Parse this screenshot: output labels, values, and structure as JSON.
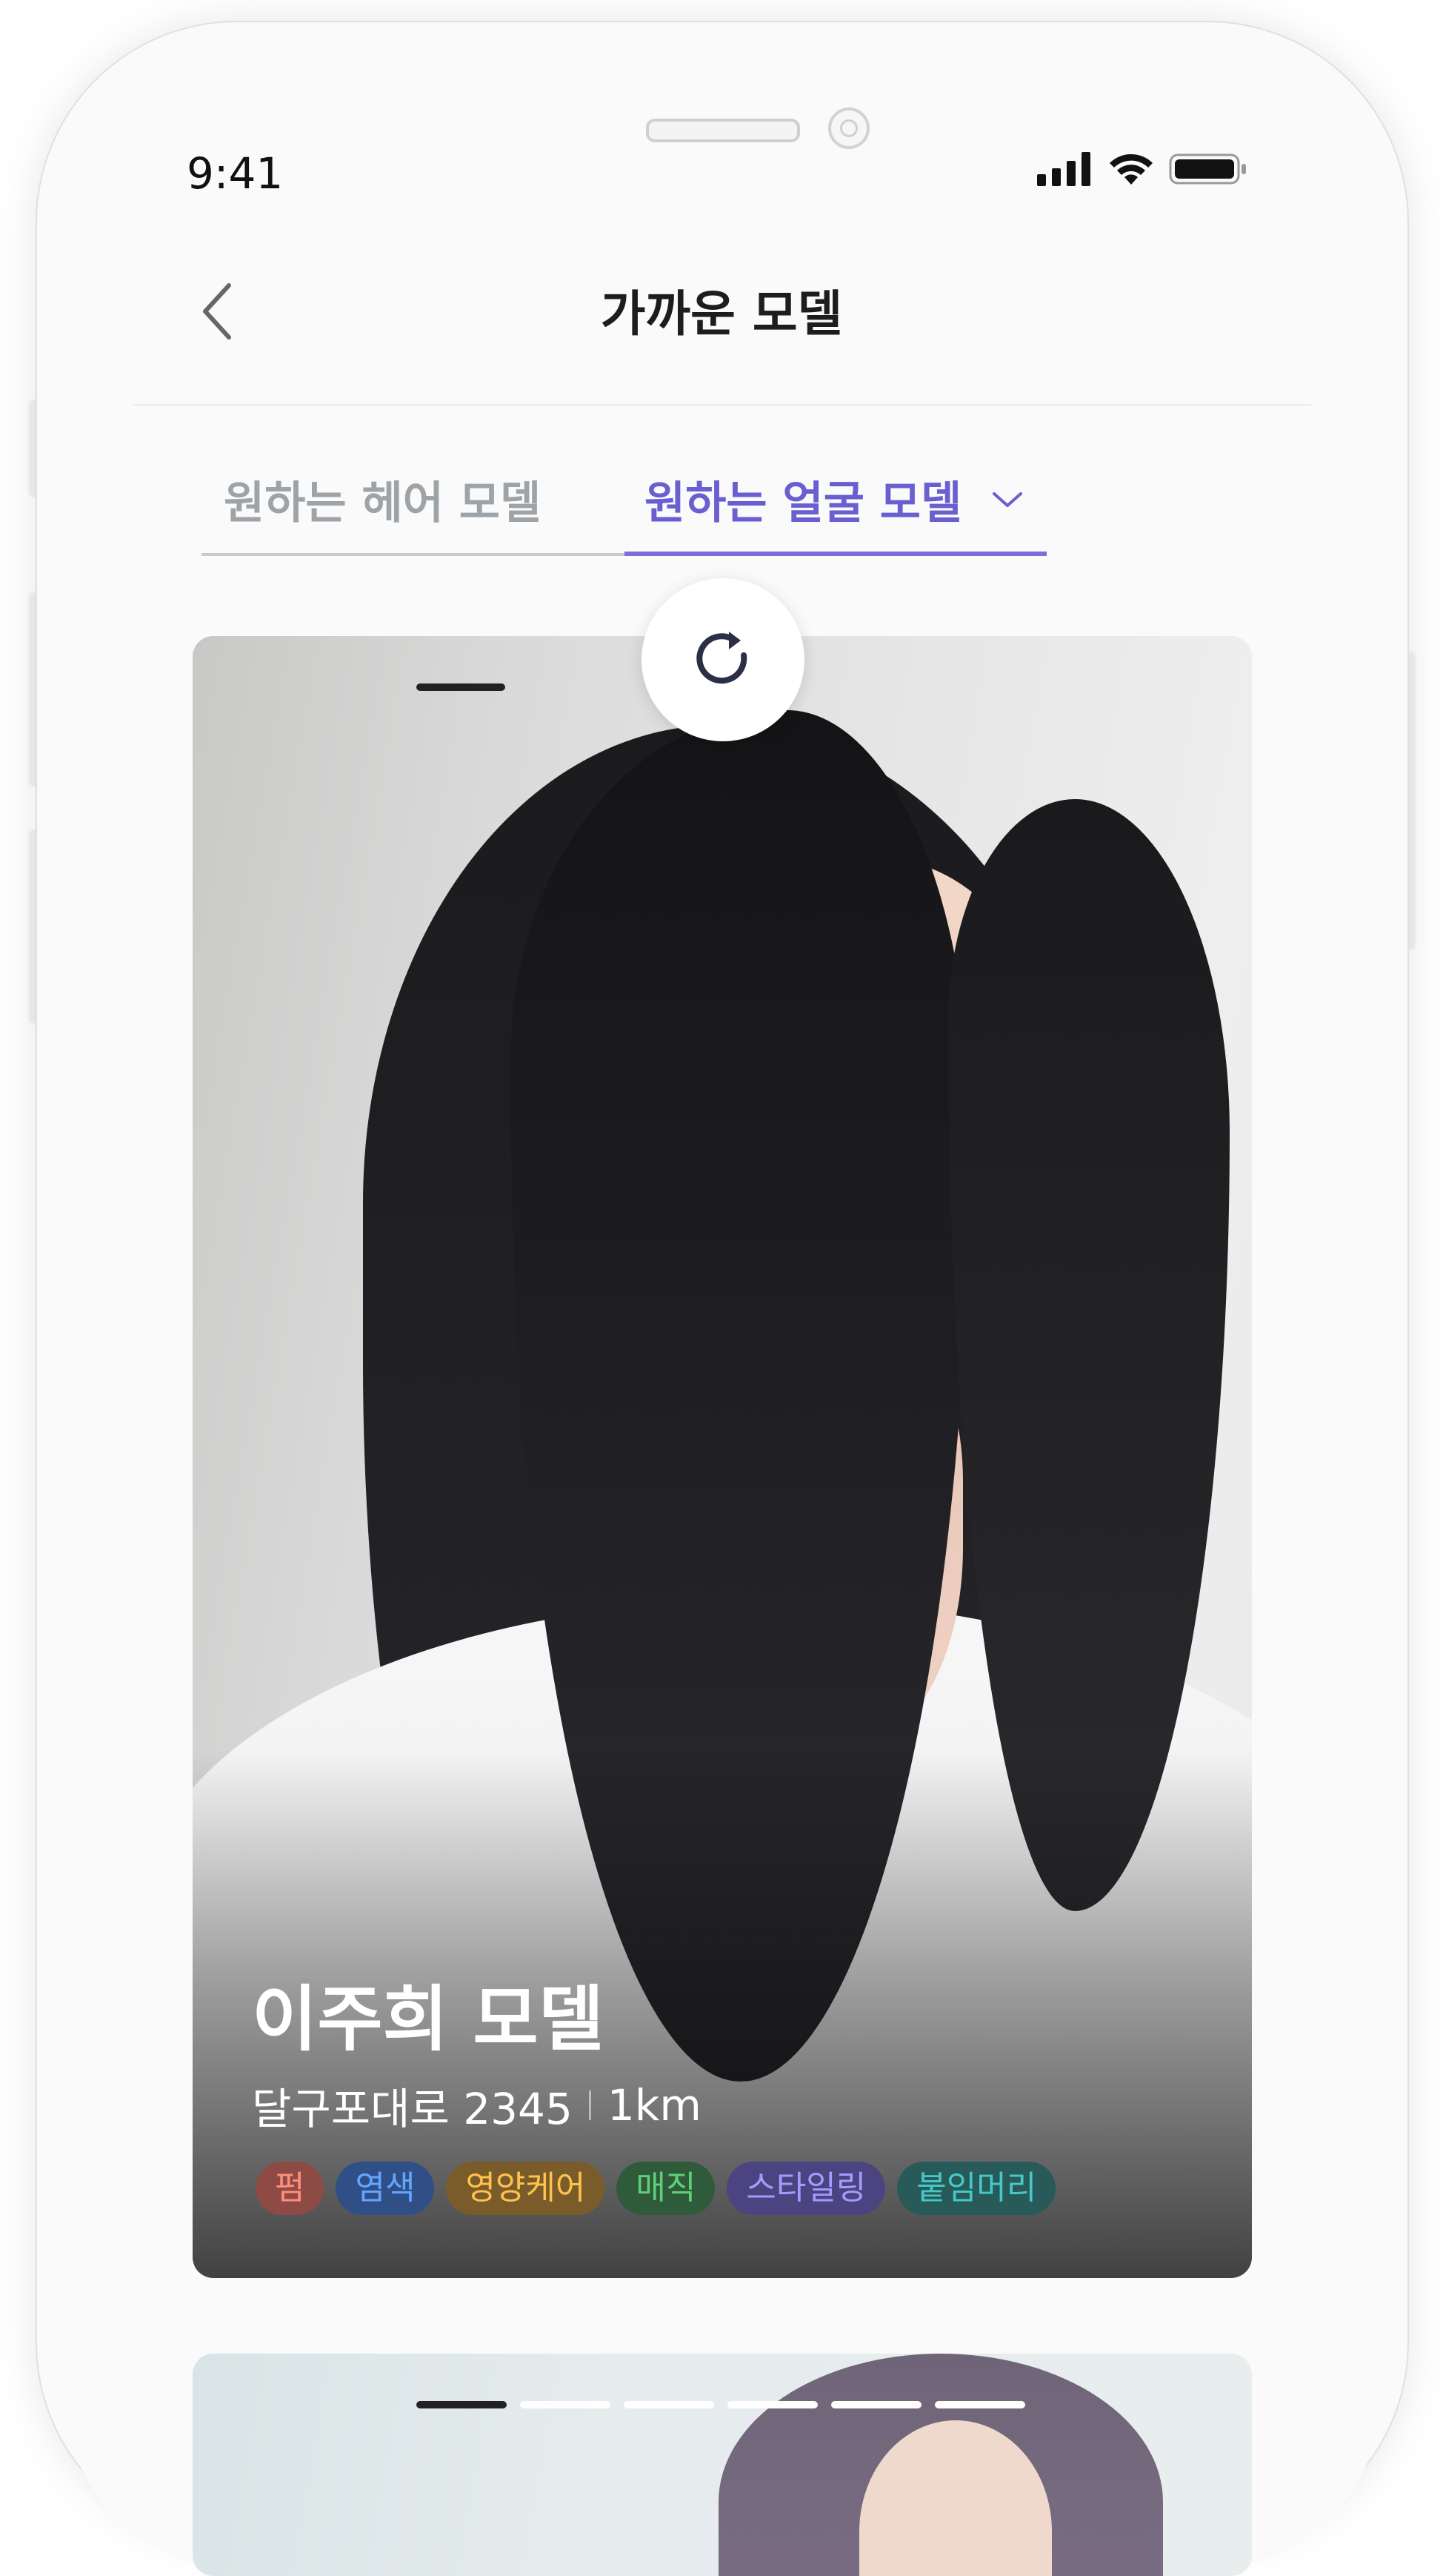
{
  "status_bar": {
    "time": "9:41"
  },
  "header": {
    "title": "가까운 모델"
  },
  "tabs": [
    {
      "label": "원하는 헤어 모델",
      "active": false
    },
    {
      "label": "원하는 얼굴 모델",
      "active": true
    }
  ],
  "cards": [
    {
      "name": "이주희 모델",
      "address": "달구포대로 2345",
      "distance": "1km",
      "tags": [
        {
          "label": "펌",
          "bg": "#8e4a44",
          "color": "#ff8f7a"
        },
        {
          "label": "염색",
          "bg": "#2f4f86",
          "color": "#64a6ff"
        },
        {
          "label": "영양케어",
          "bg": "#7a5c2a",
          "color": "#ffc24d"
        },
        {
          "label": "매직",
          "bg": "#2f5b3a",
          "color": "#5fd07a"
        },
        {
          "label": "스타일링",
          "bg": "#4b4480",
          "color": "#a39cff"
        },
        {
          "label": "붙임머리",
          "bg": "#285a5a",
          "color": "#47c8c8"
        }
      ]
    }
  ],
  "colors": {
    "accent": "#6a5fd0",
    "inactive_tab": "#9ea3a8"
  },
  "icons": {
    "back": "chevron-left-icon",
    "dropdown": "chevron-down-icon",
    "refresh": "refresh-icon"
  }
}
